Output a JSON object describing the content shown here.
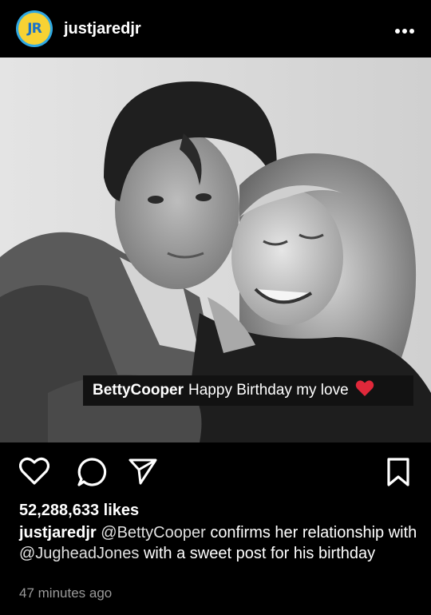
{
  "header": {
    "avatar_text": "JR",
    "username": "justjaredjr",
    "more_icon": "more-horizontal-icon"
  },
  "post": {
    "overlay_user": "BettyCooper",
    "overlay_text": "Happy Birthday my love",
    "overlay_heart": "❤️"
  },
  "actions": {
    "like_icon": "heart-icon",
    "comment_icon": "comment-icon",
    "share_icon": "send-icon",
    "save_icon": "bookmark-icon"
  },
  "likes": "52,288,633 likes",
  "caption": {
    "username": "justjaredjr",
    "mention1": "@BettyCooper",
    "text1": "confirms her relationship with",
    "mention2": "@JugheadJones",
    "text2": "with a sweet post for his birthday"
  },
  "timestamp": "47 minutes ago"
}
